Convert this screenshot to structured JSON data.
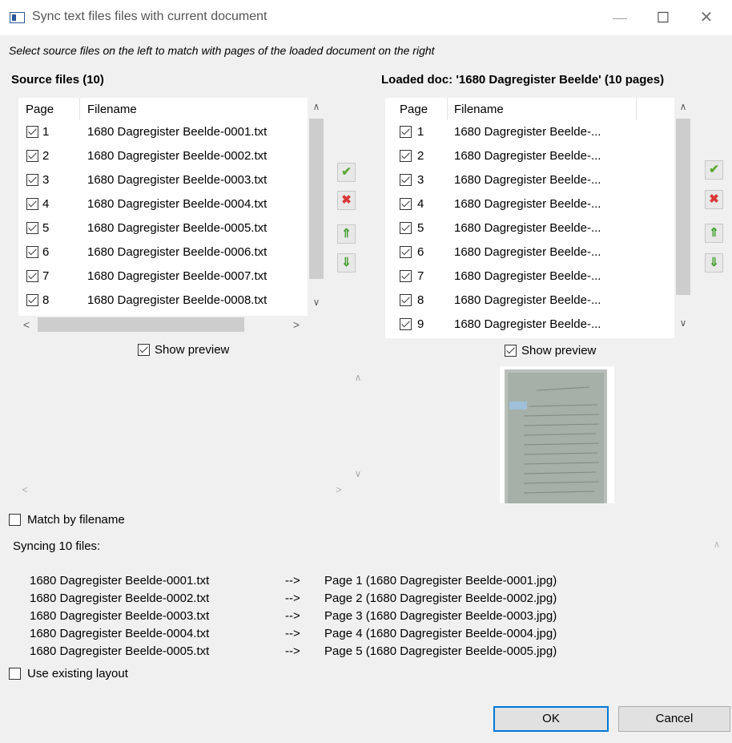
{
  "window": {
    "title": "Sync text files files with current document"
  },
  "instruction": "Select source files on the left to match with pages of the loaded document on the right",
  "source": {
    "title": "Source files (10)",
    "col_page": "Page",
    "col_filename": "Filename",
    "rows": [
      {
        "page": "1",
        "filename": "1680 Dagregister Beelde-0001.txt"
      },
      {
        "page": "2",
        "filename": "1680 Dagregister Beelde-0002.txt"
      },
      {
        "page": "3",
        "filename": "1680 Dagregister Beelde-0003.txt"
      },
      {
        "page": "4",
        "filename": "1680 Dagregister Beelde-0004.txt"
      },
      {
        "page": "5",
        "filename": "1680 Dagregister Beelde-0005.txt"
      },
      {
        "page": "6",
        "filename": "1680 Dagregister Beelde-0006.txt"
      },
      {
        "page": "7",
        "filename": "1680 Dagregister Beelde-0007.txt"
      },
      {
        "page": "8",
        "filename": "1680 Dagregister Beelde-0008.txt"
      }
    ],
    "show_preview": "Show preview"
  },
  "loaded": {
    "title": "Loaded doc: '1680 Dagregister Beelde' (10 pages)",
    "col_page": "Page",
    "col_filename": "Filename",
    "rows": [
      {
        "page": "1",
        "filename": "1680 Dagregister Beelde-..."
      },
      {
        "page": "2",
        "filename": "1680 Dagregister Beelde-..."
      },
      {
        "page": "3",
        "filename": "1680 Dagregister Beelde-..."
      },
      {
        "page": "4",
        "filename": "1680 Dagregister Beelde-..."
      },
      {
        "page": "5",
        "filename": "1680 Dagregister Beelde-..."
      },
      {
        "page": "6",
        "filename": "1680 Dagregister Beelde-..."
      },
      {
        "page": "7",
        "filename": "1680 Dagregister Beelde-..."
      },
      {
        "page": "8",
        "filename": "1680 Dagregister Beelde-..."
      },
      {
        "page": "9",
        "filename": "1680 Dagregister Beelde-..."
      }
    ],
    "show_preview": "Show preview"
  },
  "icons": {
    "check": "✔",
    "remove": "✖",
    "up": "⇑",
    "down": "⇓",
    "scroll_up": "∧",
    "scroll_down": "∨",
    "scroll_left": "<",
    "scroll_right": ">",
    "minimize": "—",
    "maximize": "☐",
    "close": "✕"
  },
  "match_by_filename": "Match by filename",
  "sync": {
    "title": "Syncing 10 files:",
    "arrow": "-->",
    "rows": [
      {
        "source": "1680 Dagregister Beelde-0001.txt",
        "target": "Page 1 (1680 Dagregister Beelde-0001.jpg)"
      },
      {
        "source": "1680 Dagregister Beelde-0002.txt",
        "target": "Page 2 (1680 Dagregister Beelde-0002.jpg)"
      },
      {
        "source": "1680 Dagregister Beelde-0003.txt",
        "target": "Page 3 (1680 Dagregister Beelde-0003.jpg)"
      },
      {
        "source": "1680 Dagregister Beelde-0004.txt",
        "target": "Page 4 (1680 Dagregister Beelde-0004.jpg)"
      },
      {
        "source": "1680 Dagregister Beelde-0005.txt",
        "target": "Page 5 (1680 Dagregister Beelde-0005.jpg)"
      }
    ]
  },
  "use_existing_layout": "Use existing layout",
  "buttons": {
    "ok": "OK",
    "cancel": "Cancel"
  },
  "colors": {
    "accent": "#0078d7",
    "ok_green": "#5aa832",
    "remove_red": "#d93838"
  }
}
